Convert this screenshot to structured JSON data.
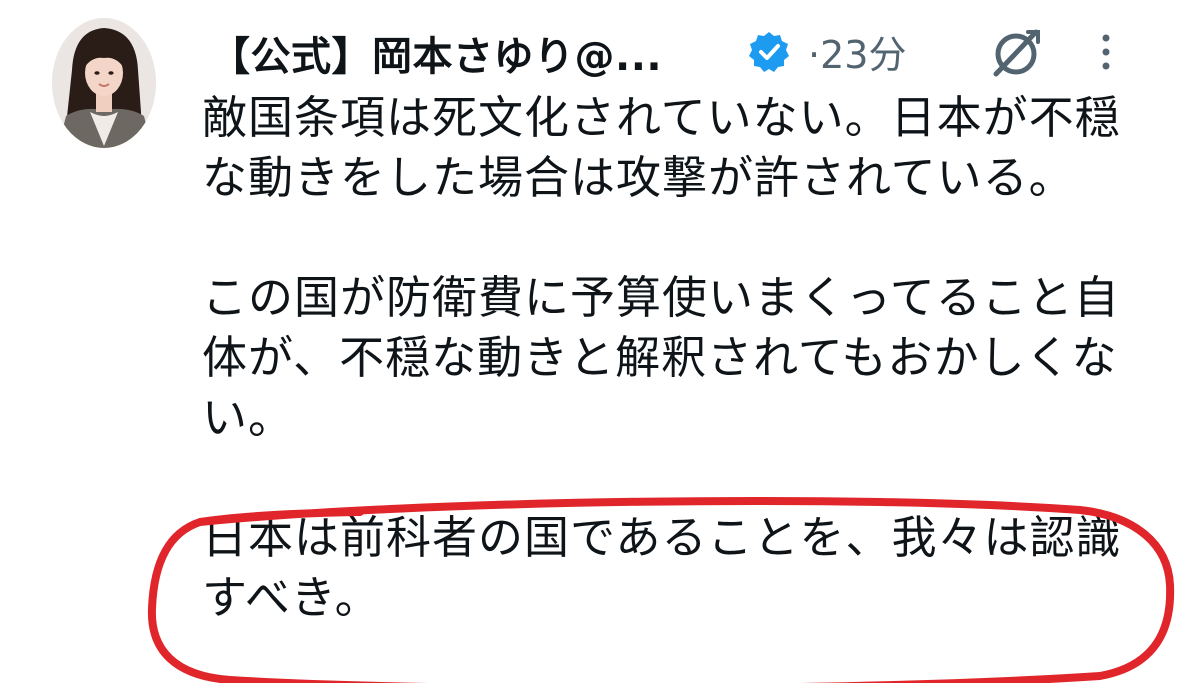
{
  "tweet": {
    "author_name": "【公式】岡本さゆり@...",
    "separator": "·",
    "time_ago": "23分",
    "verified_badge_icon": "verified-badge-icon",
    "grok_icon": "grok-icon",
    "more_icon": "more-options-icon",
    "avatar_icon": "profile-photo",
    "paragraphs": [
      "敵国条項は死文化されていない。日本が不穏\nな動きをした場合は攻撃が許されている。",
      "この国が防衛費に予算使いまくってること自\n体が、不穏な動きと解釈されてもおかしくな\nい。",
      "日本は前科者の国であることを、我々は認識\nすべき。"
    ]
  },
  "annotation": {
    "type": "hand-drawn-ellipse",
    "color": "#e0262a"
  },
  "colors": {
    "verified_blue": "#1d9bf0",
    "muted_text": "#536471",
    "primary_text": "#0f1419"
  }
}
